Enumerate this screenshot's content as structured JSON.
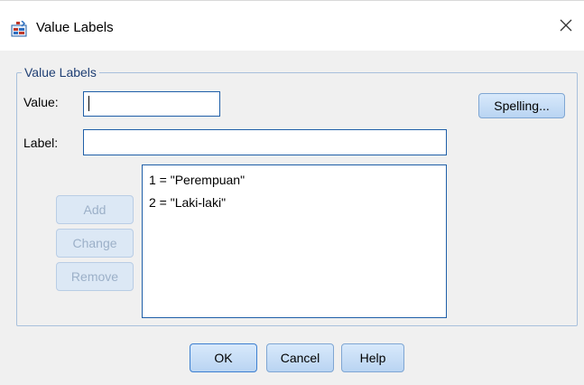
{
  "dialog": {
    "title": "Value Labels",
    "icon": "value-labels-app-icon",
    "close_icon": "close-icon"
  },
  "group": {
    "legend": "Value Labels"
  },
  "form": {
    "value_label": "Value:",
    "value_value": "",
    "label_label": "Label:",
    "label_value": ""
  },
  "buttons": {
    "spelling": "Spelling...",
    "add": "Add",
    "change": "Change",
    "remove": "Remove",
    "ok": "OK",
    "cancel": "Cancel",
    "help": "Help"
  },
  "value_labels": [
    "1 = \"Perempuan\"",
    "2 = \"Laki-laki\""
  ],
  "colors": {
    "accent_border": "#1f5fa8",
    "group_border": "#a8c0dc",
    "legend_text": "#1f3f74",
    "button_gradient_top": "#d8e9fb",
    "button_gradient_bottom": "#b9d4f2",
    "disabled_text": "#9cb0c8"
  }
}
